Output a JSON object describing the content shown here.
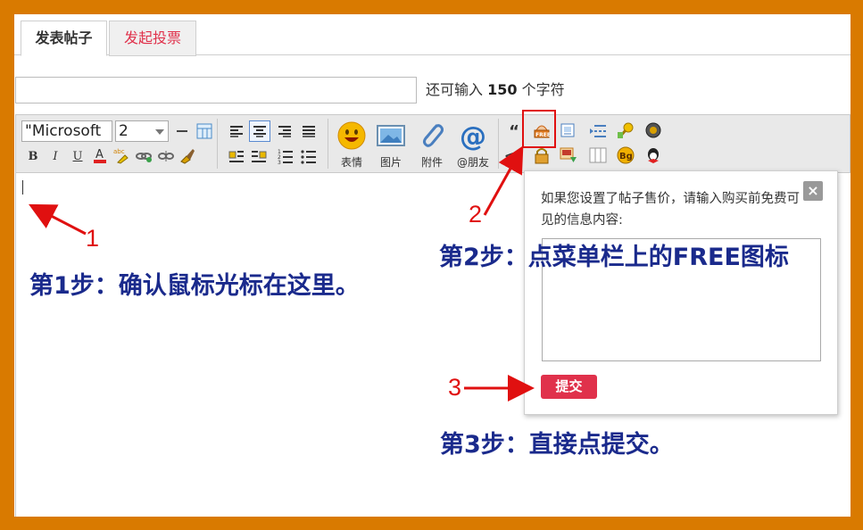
{
  "tabs": [
    {
      "label": "发表帖子",
      "active": true
    },
    {
      "label": "发起投票",
      "active": false
    }
  ],
  "title_field": {
    "value": "",
    "hint_prefix": "还可输入",
    "hint_count": "150",
    "hint_suffix": "个字符"
  },
  "toolbar": {
    "font_family": "\"Microsoft",
    "font_size": "2",
    "big_buttons": [
      "表情",
      "图片",
      "附件",
      "@朋友"
    ]
  },
  "popup": {
    "text": "如果您设置了帖子售价，请输入购买前免费可见的信息内容:",
    "close_label": "×",
    "submit_label": "提交"
  },
  "annotations": {
    "step1": "第1步：确认鼠标光标在这里。",
    "step2": "第2步：点菜单栏上的FREE图标",
    "step3": "第3步：直接点提交。",
    "num1": "1",
    "num2": "2",
    "num3": "3"
  },
  "colors": {
    "frame": "#d97a00",
    "accent": "#e0314b",
    "annotation_text": "#1a2a8c",
    "annotation_marker": "#e01010"
  }
}
